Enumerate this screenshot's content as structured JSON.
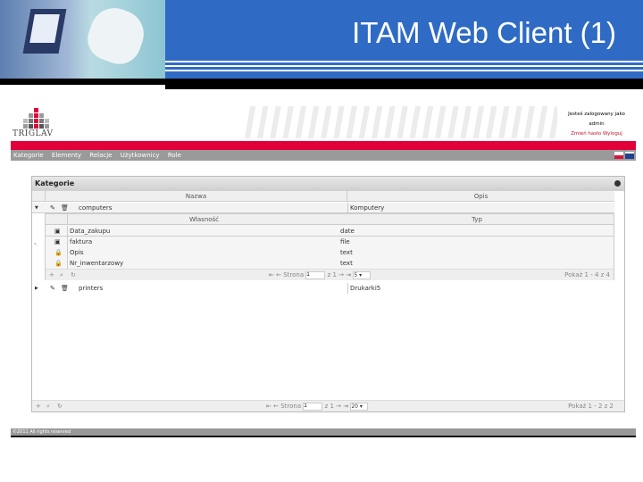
{
  "slide": {
    "title": "ITAM Web Client (1)"
  },
  "app": {
    "brand": "TRIGLAV",
    "login": {
      "line1": "Jesteś zalogowany jako",
      "user": "admin",
      "links": "Zmień hasło Wyloguj"
    },
    "nav": [
      "Kategorie",
      "Elementy",
      "Relacje",
      "Użytkownicy",
      "Role"
    ],
    "panel": {
      "title": "Kategorie",
      "columns": [
        "Nazwa",
        "Opis"
      ],
      "rows": [
        {
          "name": "computers",
          "desc": "Komputery",
          "expanded": true
        },
        {
          "name": "printers",
          "desc": "Drukarki5",
          "expanded": false
        }
      ],
      "subgrid": {
        "columns": [
          "Własność",
          "Typ"
        ],
        "rows": [
          {
            "name": "Data_zakupu",
            "type": "date"
          },
          {
            "name": "faktura",
            "type": "file"
          },
          {
            "name": "Opis",
            "type": "text"
          },
          {
            "name": "Nr_inwentarzowy",
            "type": "text"
          }
        ],
        "pager": {
          "page_label": "Strona",
          "page": "1",
          "of": "z 1",
          "per_page": "5",
          "summary": "Pokaż 1 - 4 z 4"
        }
      },
      "pager": {
        "page_label": "Strona",
        "page": "1",
        "of": "z 1",
        "per_page": "20",
        "summary": "Pokaż 1 - 2 z 2"
      }
    },
    "footer": "©2011 All rights reserved"
  }
}
